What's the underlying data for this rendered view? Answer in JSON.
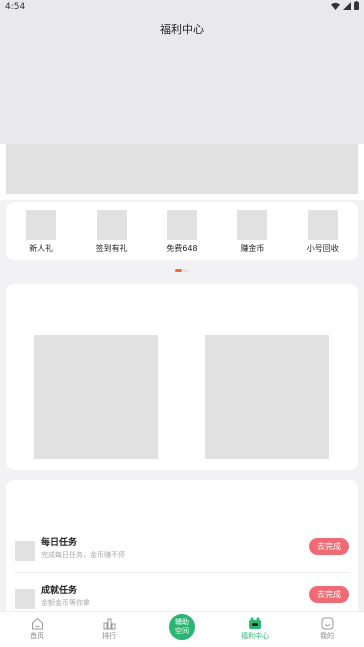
{
  "status_bar": {
    "time": "4:54"
  },
  "header": {
    "title": "福利中心"
  },
  "shortcuts": [
    {
      "label": "新人礼"
    },
    {
      "label": "签到有礼"
    },
    {
      "label": "免费648"
    },
    {
      "label": "赚金币"
    },
    {
      "label": "小号回收"
    }
  ],
  "tasks": [
    {
      "title": "每日任务",
      "subtitle": "完成每日任务，金币赚不停",
      "button": "去完成"
    },
    {
      "title": "成就任务",
      "subtitle": "金额金币等你拿",
      "button": "去完成"
    }
  ],
  "tab_bar": {
    "tabs": [
      {
        "label": "首页"
      },
      {
        "label": "排行"
      },
      {
        "label": "福利中心"
      },
      {
        "label": "我的"
      }
    ],
    "center_button": "辅助空间"
  },
  "colors": {
    "accent_green": "#2bb673",
    "button_red": "#ee6b75",
    "pager_active": "#f26a3b"
  }
}
